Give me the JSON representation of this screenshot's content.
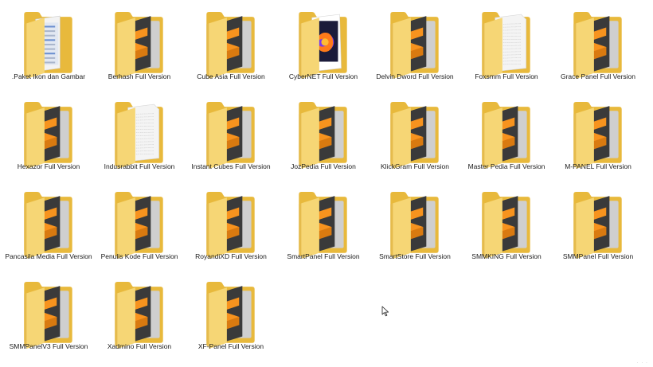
{
  "colors": {
    "folder_back": "#e8b93c",
    "folder_front": "#f6d675",
    "folder_front_edge": "#e5bb4d",
    "doc_dark": "#3a3a3a",
    "doc_orange": "#f7931e",
    "paper": "#f4f4f4"
  },
  "folders": [
    {
      "label": ".Paket Ikon dan Gambar",
      "icon": "folder-docs-icon"
    },
    {
      "label": "Berhash Full Version",
      "icon": "folder-sublime-icon"
    },
    {
      "label": "Cube Asia Full Version",
      "icon": "folder-sublime-icon"
    },
    {
      "label": "CyberNET Full Version",
      "icon": "folder-firefox-icon"
    },
    {
      "label": "Delvin Dword Full Version",
      "icon": "folder-sublime-icon"
    },
    {
      "label": "Foxsmm Full Version",
      "icon": "folder-paper-icon"
    },
    {
      "label": "Grace Panel Full Version",
      "icon": "folder-sublime-icon"
    },
    {
      "label": "Hexazor Full Version",
      "icon": "folder-sublime-icon"
    },
    {
      "label": "Indusrabbit Full Version",
      "icon": "folder-paper-icon"
    },
    {
      "label": "Instant Cubes Full Version",
      "icon": "folder-sublime-icon"
    },
    {
      "label": "JozPedia Full Version",
      "icon": "folder-sublime-icon"
    },
    {
      "label": "KlickGram Full Version",
      "icon": "folder-sublime-icon"
    },
    {
      "label": "Master Pedia Full Version",
      "icon": "folder-sublime-icon"
    },
    {
      "label": "M-PANEL Full Version",
      "icon": "folder-sublime-icon"
    },
    {
      "label": "Pancasila Media Full Version",
      "icon": "folder-sublime-icon"
    },
    {
      "label": "Penulis Kode Full Version",
      "icon": "folder-sublime-icon"
    },
    {
      "label": "RoyandiXD Full Version",
      "icon": "folder-sublime-icon"
    },
    {
      "label": "SmartPanel Full Version",
      "icon": "folder-sublime-icon"
    },
    {
      "label": "SmartStore Full Version",
      "icon": "folder-sublime-icon"
    },
    {
      "label": "SMMKING Full Version",
      "icon": "folder-sublime-icon"
    },
    {
      "label": "SMMPanel Full Version",
      "icon": "folder-sublime-icon"
    },
    {
      "label": "SMMPanelV3 Full Version",
      "icon": "folder-sublime-icon"
    },
    {
      "label": "Xadmino Full Version",
      "icon": "folder-sublime-icon"
    },
    {
      "label": "XF-Panel Full Version",
      "icon": "folder-sublime-icon"
    }
  ],
  "cursor_icon": "mouse-pointer-icon"
}
